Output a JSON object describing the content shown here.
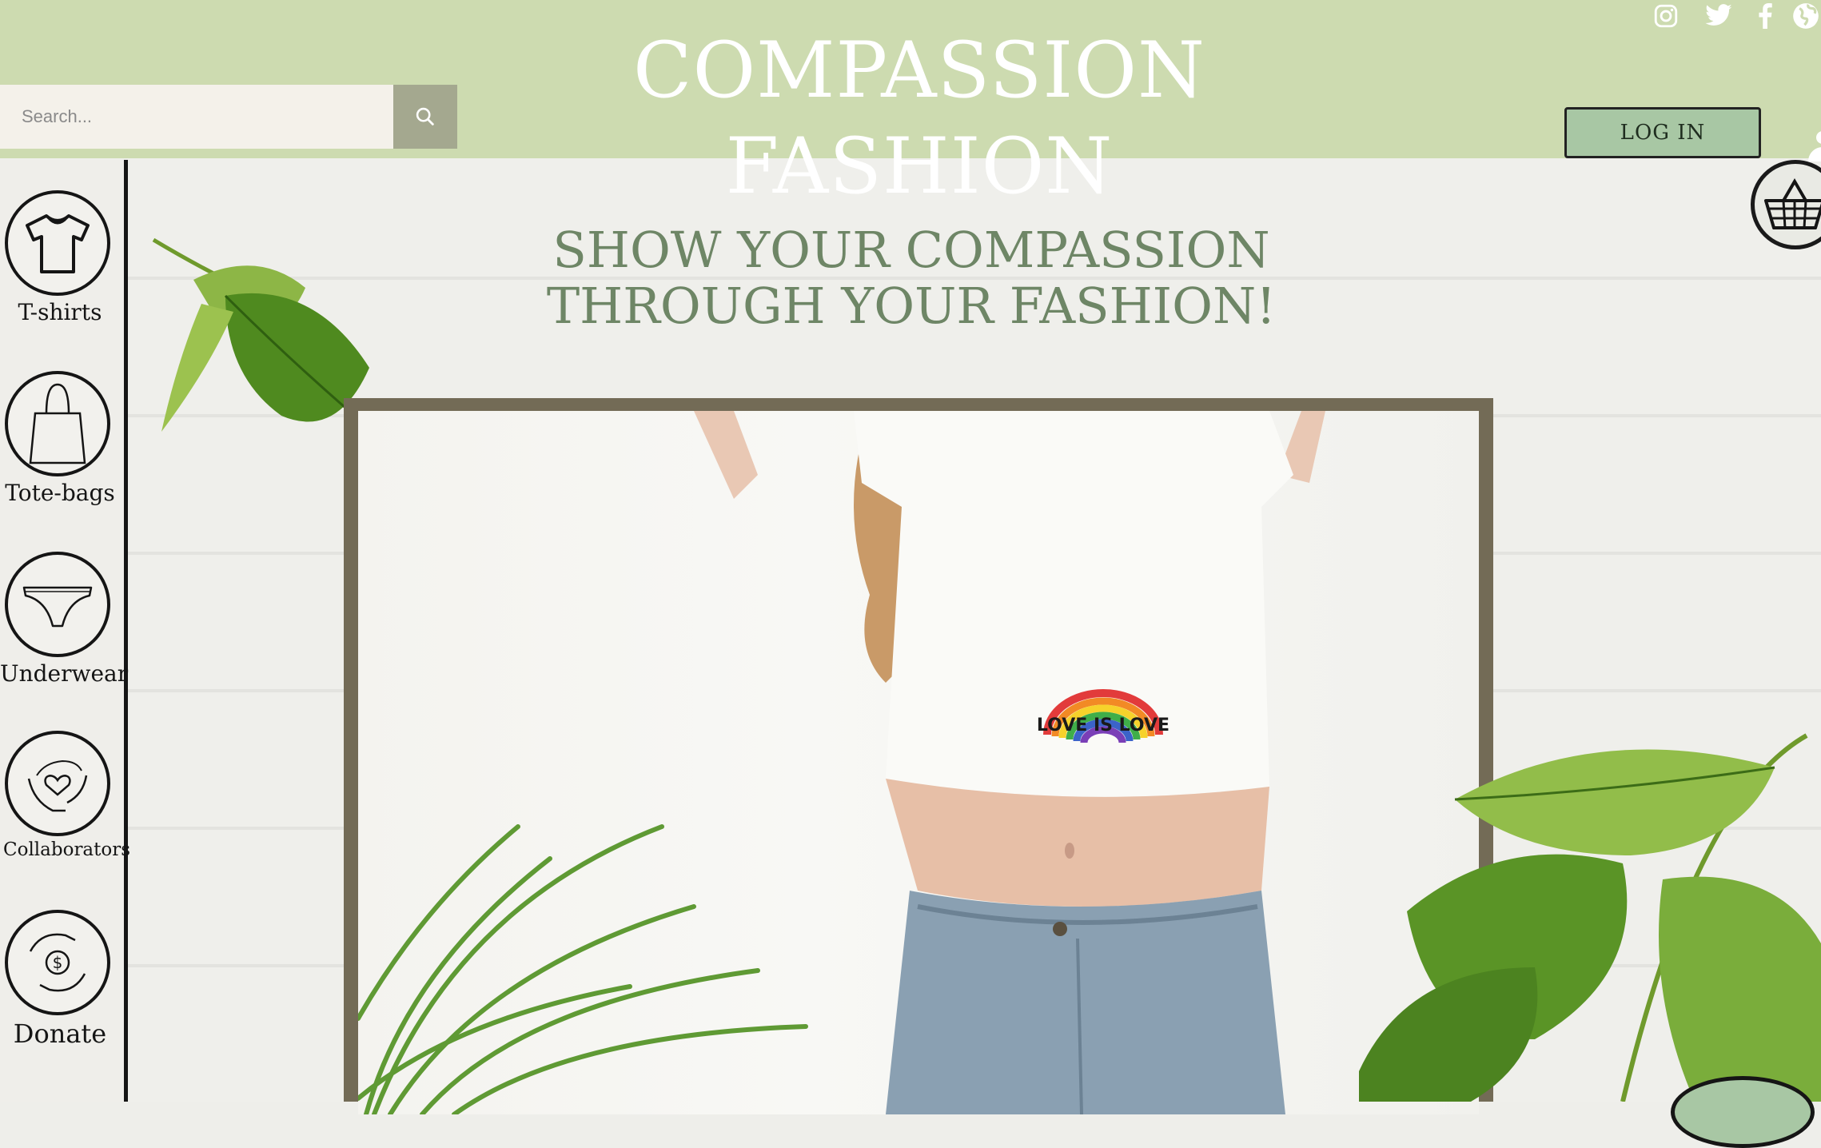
{
  "header": {
    "site_title": "COMPASSION FASHION",
    "search_placeholder": "Search...",
    "login_label": "LOG IN",
    "social_icons": [
      "instagram-icon",
      "twitter-icon",
      "facebook-icon",
      "globe-icon"
    ]
  },
  "sidebar": {
    "items": [
      {
        "label": "T-shirts",
        "icon": "tshirt-icon"
      },
      {
        "label": "Tote-bags",
        "icon": "tote-bag-icon"
      },
      {
        "label": "Underwear",
        "icon": "underwear-icon"
      },
      {
        "label": "Collaborators",
        "icon": "hands-heart-icon"
      },
      {
        "label": "Donate",
        "icon": "hands-coin-icon"
      }
    ]
  },
  "hero": {
    "tagline_line1": "SHOW YOUR COMPASSION",
    "tagline_line2": "THROUGH YOUR FASHION!",
    "shirt_print": "LOVE IS LOVE"
  },
  "colors": {
    "header_bg": "#cddbb0",
    "accent_green": "#6e8666",
    "login_bg": "#a8c7a4",
    "frame": "#736b56"
  }
}
